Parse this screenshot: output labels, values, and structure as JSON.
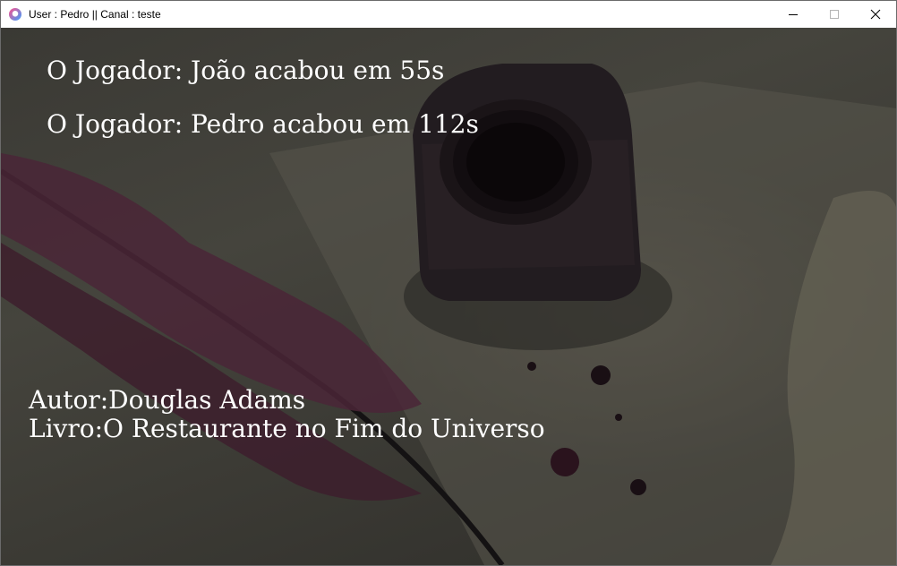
{
  "window": {
    "title": "User : Pedro || Canal : teste"
  },
  "messages": [
    "O Jogador: João acabou em 55s",
    "O Jogador: Pedro acabou em 112s"
  ],
  "book": {
    "author": "Autor:Douglas Adams",
    "title": "Livro:O Restaurante no Fim do Universo"
  },
  "icons": {
    "app": "heart-logo-icon",
    "minimize": "minimize-icon",
    "maximize": "maximize-icon",
    "close": "close-icon"
  }
}
